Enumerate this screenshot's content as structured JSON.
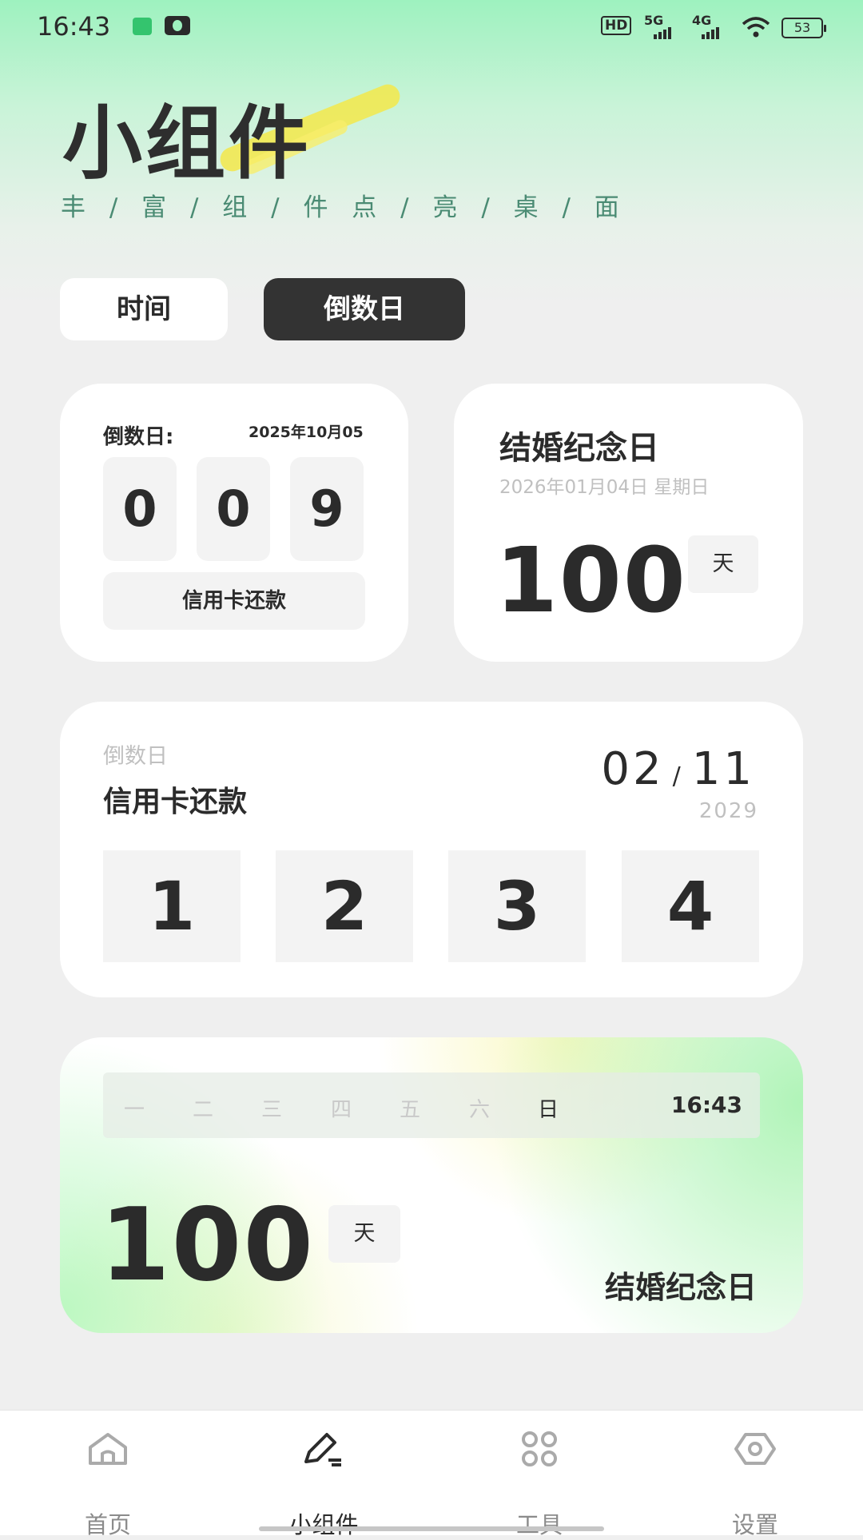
{
  "status_bar": {
    "time": "16:43",
    "hd": "HD",
    "signal1": "5G",
    "signal2": "4G",
    "battery": "53"
  },
  "hero": {
    "title": "小组件",
    "subtitle": "丰 / 富 / 组 / 件   点 / 亮 / 桌 / 面"
  },
  "tabs": [
    {
      "label": "时间",
      "selected": false
    },
    {
      "label": "倒数日",
      "selected": true
    }
  ],
  "card_countdown_small": {
    "label": "倒数日:",
    "date": "2025年10月05",
    "digits": [
      "0",
      "0",
      "9"
    ],
    "name": "信用卡还款"
  },
  "card_anniversary": {
    "title": "结婚纪念日",
    "date": "2026年01月04日 星期日",
    "days": "100",
    "unit": "天"
  },
  "card_countdown_wide": {
    "label": "倒数日",
    "name": "信用卡还款",
    "month": "02",
    "separator": "/",
    "day": "11",
    "year": "2029",
    "digits": [
      "1",
      "2",
      "3",
      "4"
    ]
  },
  "card_week": {
    "weekdays": [
      "一",
      "二",
      "三",
      "四",
      "五",
      "六",
      "日"
    ],
    "active_weekday": "日",
    "time": "16:43",
    "days": "100",
    "unit": "天",
    "name": "结婚纪念日"
  },
  "bottom_nav": [
    {
      "label": "首页",
      "icon": "home-icon"
    },
    {
      "label": "小组件",
      "icon": "edit-pen-icon"
    },
    {
      "label": "工具",
      "icon": "grid-apps-icon"
    },
    {
      "label": "设置",
      "icon": "settings-hexagon-icon"
    }
  ],
  "colors": {
    "accent_dark": "#333333",
    "hero_green": "#9ef2bf",
    "subtitle_green": "#4a8b73",
    "highlight_yellow": "#f3e84a"
  }
}
